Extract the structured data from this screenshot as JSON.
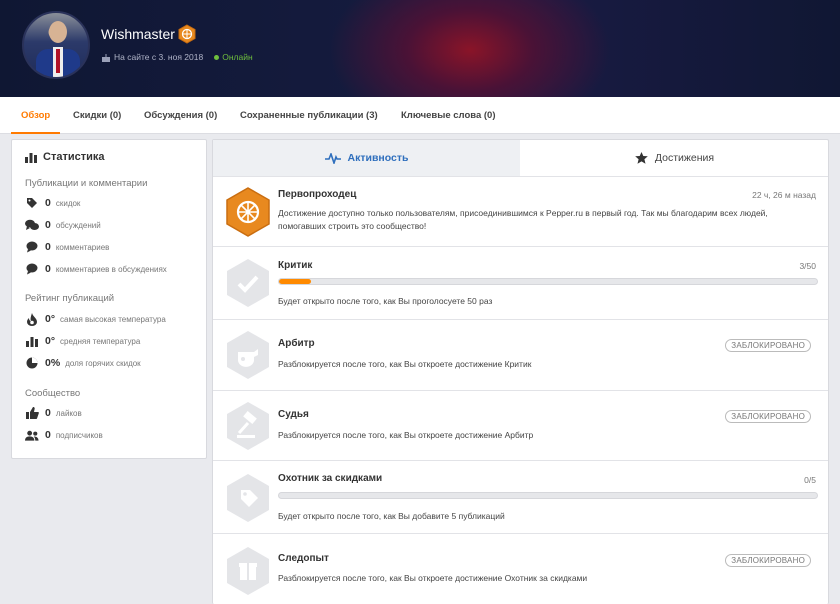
{
  "profile": {
    "username": "Wishmaster",
    "member_since": "На сайте с 3. ноя 2018",
    "status": "Онлайн"
  },
  "nav_tabs": [
    {
      "label": "Обзор",
      "active": true
    },
    {
      "label": "Скидки (0)"
    },
    {
      "label": "Обсуждения (0)"
    },
    {
      "label": "Сохраненные публикации (3)"
    },
    {
      "label": "Ключевые слова (0)"
    }
  ],
  "stats": {
    "title": "Статистика",
    "groups": [
      {
        "title": "Публикации и комментарии",
        "rows": [
          {
            "icon": "tag-icon",
            "value": "0",
            "label": "скидок"
          },
          {
            "icon": "discussions-icon",
            "value": "0",
            "label": "обсуждений"
          },
          {
            "icon": "comment-icon",
            "value": "0",
            "label": "комментариев"
          },
          {
            "icon": "comment-icon",
            "value": "0",
            "label": "комментариев в обсуждениях"
          }
        ]
      },
      {
        "title": "Рейтинг публикаций",
        "rows": [
          {
            "icon": "flame-icon",
            "value": "0°",
            "label": "самая высокая температура"
          },
          {
            "icon": "bar-chart-icon",
            "value": "0°",
            "label": "средняя температура"
          },
          {
            "icon": "pie-chart-icon",
            "value": "0%",
            "label": "доля горячих скидок"
          }
        ]
      },
      {
        "title": "Сообщество",
        "rows": [
          {
            "icon": "thumbs-up-icon",
            "value": "0",
            "label": "лайков"
          },
          {
            "icon": "users-icon",
            "value": "0",
            "label": "подписчиков"
          }
        ]
      }
    ]
  },
  "main_tabs": {
    "activity": "Активность",
    "achievements": "Достижения"
  },
  "achievements": [
    {
      "title": "Первопроходец",
      "right": "22 ч, 26 м назад",
      "desc": "Достижение доступно только пользователям, присоединившимся к Pepper.ru в первый год. Так мы благодарим всех людей, помогавших строить это сообщество!",
      "icon": "wheel-icon",
      "earned": true
    },
    {
      "title": "Критик",
      "right": "3/50",
      "progress": 0.06,
      "desc": "Будет открыто после того, как Вы проголосуете 50 раз",
      "icon": "check-icon"
    },
    {
      "title": "Арбитр",
      "locked": "ЗАБЛОКИРОВАНО",
      "desc": "Разблокируется после того, как Вы откроете достижение Критик",
      "icon": "whistle-icon"
    },
    {
      "title": "Судья",
      "locked": "ЗАБЛОКИРОВАНО",
      "desc": "Разблокируется после того, как Вы откроете достижение Арбитр",
      "icon": "gavel-icon"
    },
    {
      "title": "Охотник за скидками",
      "right": "0/5",
      "progress": 0,
      "desc": "Будет открыто после того, как Вы добавите 5 публикаций",
      "icon": "tag-icon"
    },
    {
      "title": "Следопыт",
      "locked": "ЗАБЛОКИРОВАНО",
      "desc": "Разблокируется после того, как Вы откроете достижение Охотник за скидками",
      "icon": "gift-icon"
    }
  ],
  "colors": {
    "accent": "#ff7a00",
    "link": "#2f6fbd",
    "online": "#6fbf3d"
  }
}
